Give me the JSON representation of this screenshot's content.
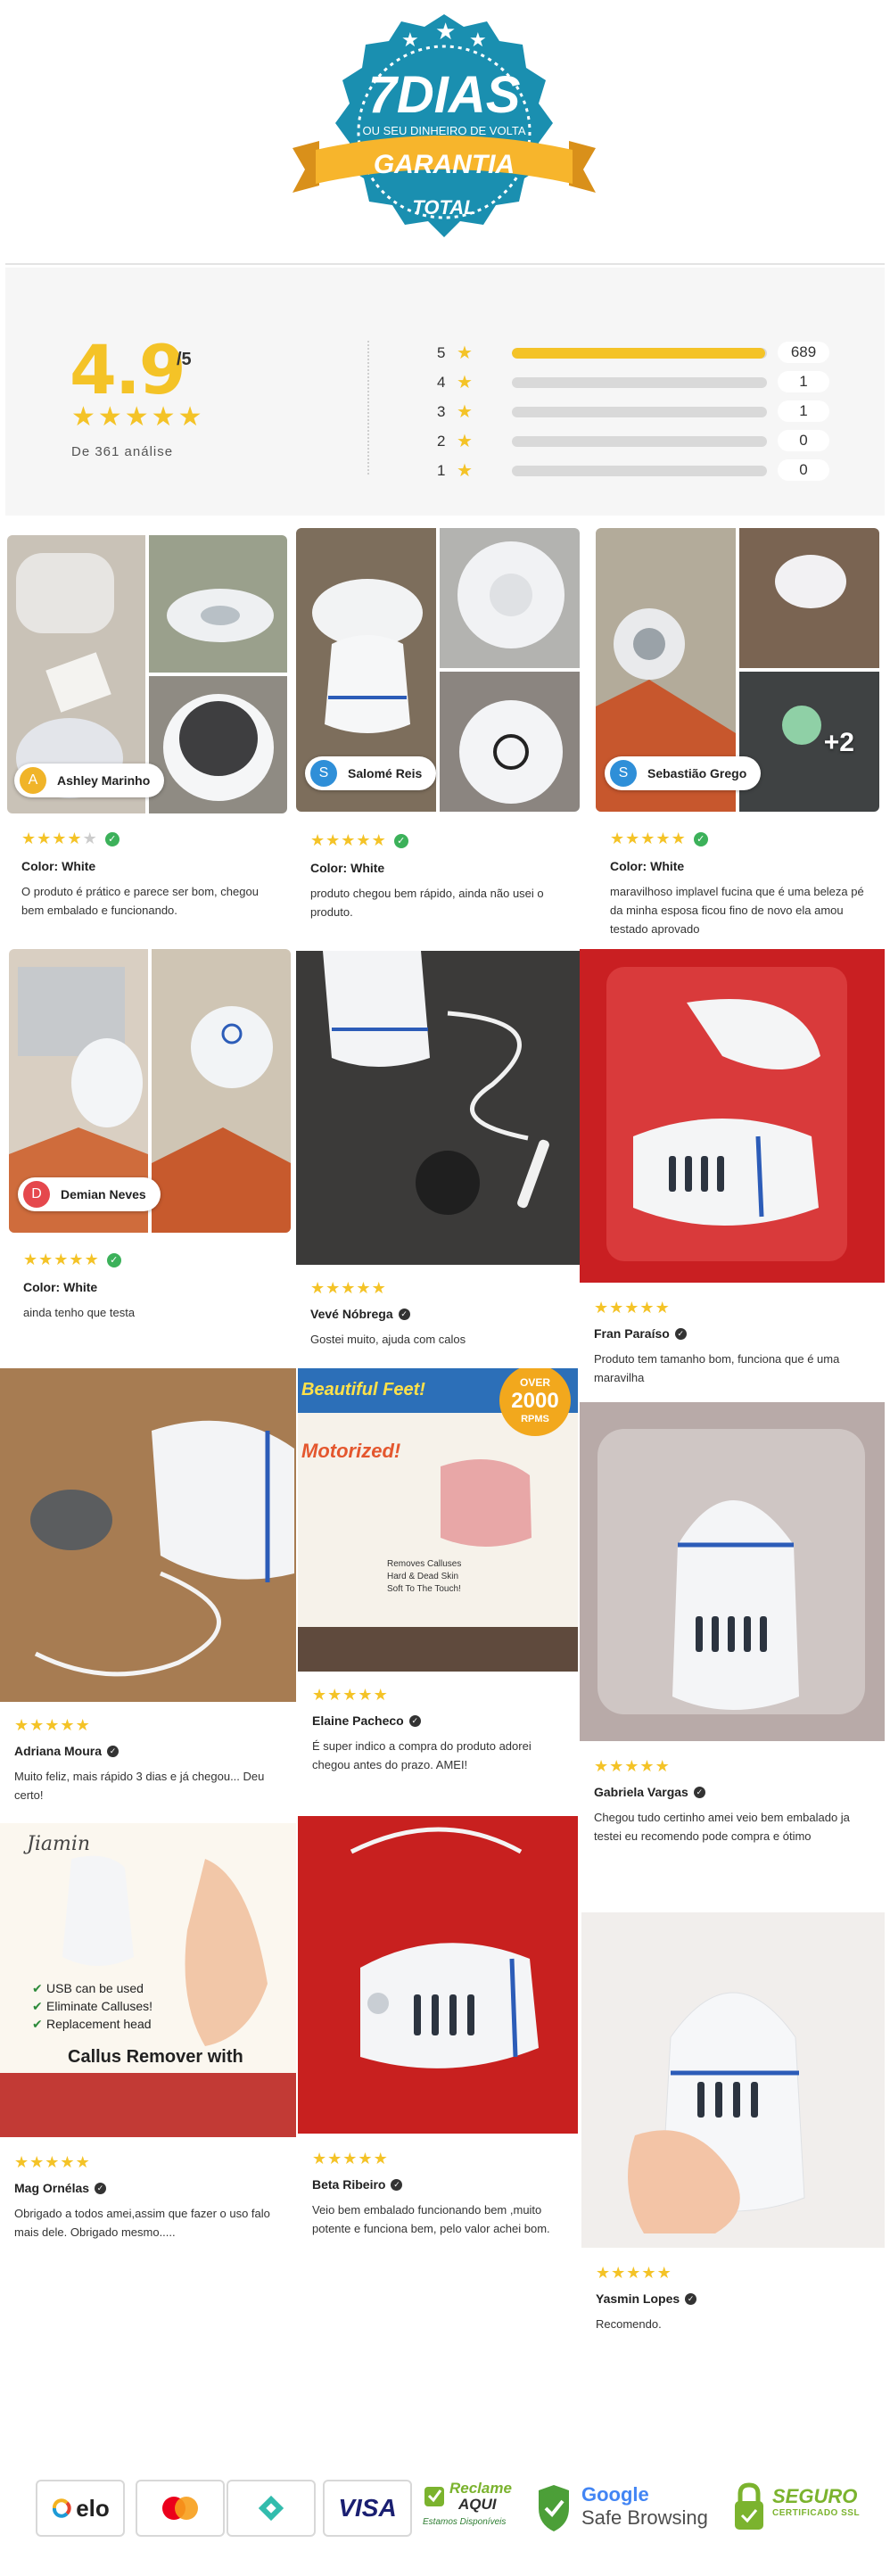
{
  "badge": {
    "big": "7DIAS",
    "sub": "OU SEU DINHEIRO DE VOLTA",
    "ribbon": "GARANTIA",
    "bottom": "TOTAL"
  },
  "summary": {
    "average": "4.9",
    "scale": "/5",
    "stars": "★★★★★",
    "count_text": "De 361 análise",
    "distribution": [
      {
        "stars": "5",
        "count": "689",
        "fraction": 0.994
      },
      {
        "stars": "4",
        "count": "1",
        "fraction": 0.0
      },
      {
        "stars": "3",
        "count": "1",
        "fraction": 0.0
      },
      {
        "stars": "2",
        "count": "0",
        "fraction": 0.0
      },
      {
        "stars": "1",
        "count": "0",
        "fraction": 0.0
      }
    ]
  },
  "reviews": [
    {
      "author": "Ashley Marinho",
      "initial": "A",
      "avatar_color": "#f0b429",
      "rating": 4,
      "color_label": "Color: White",
      "text": "O produto é prático e parece ser bom, chegou bem embalado e funcionando."
    },
    {
      "author": "Salomé Reis",
      "initial": "S",
      "avatar_color": "#2f8fd8",
      "rating": 5,
      "color_label": "Color: White",
      "text": "produto chegou bem rápido, ainda não usei o produto."
    },
    {
      "author": "Sebastião Grego",
      "initial": "S",
      "avatar_color": "#2f8fd8",
      "rating": 5,
      "color_label": "Color: White",
      "text": "maravilhoso implavel fucina que é uma beleza pé da minha esposa ficou fino de novo ela amou testado aprovado",
      "more_photos": "+2"
    },
    {
      "author": "Demian Neves",
      "initial": "D",
      "avatar_color": "#e5484d",
      "rating": 5,
      "color_label": "Color: White",
      "text": "ainda tenho que testa"
    },
    {
      "author": "Vevé Nóbrega",
      "rating": 5,
      "text": "Gostei muito, ajuda com calos"
    },
    {
      "author": "Fran Paraíso",
      "rating": 5,
      "text": "Produto tem tamanho bom, funciona que é uma maravilha"
    },
    {
      "author": "Adriana Moura",
      "rating": 5,
      "text": "Muito feliz, mais rápido 3 dias e já chegou... Deu certo!"
    },
    {
      "author": "Elaine Pacheco",
      "rating": 5,
      "text": "É super indico a compra do produto adorei chegou antes do prazo. AMEI!",
      "photo_text": {
        "top": "Beautiful Feet!",
        "badge_top": "OVER",
        "badge_mid": "2000",
        "badge_bot": "RPMS",
        "motor": "Motorized!",
        "box_line1": "Removes Calluses",
        "box_line2": "Hard & Dead Skin",
        "box_line3": "Soft To The Touch!"
      }
    },
    {
      "author": "Gabriela Vargas",
      "rating": 5,
      "text": "Chegou tudo certinho amei veio bem embalado ja testei eu recomendo pode compra e ótimo"
    },
    {
      "author": "Mag Ornélas",
      "rating": 5,
      "text": "Obrigado a todos amei,assim que fazer o uso falo mais dele. Obrigado mesmo.....",
      "photo_text": {
        "brand": "Jiamin",
        "bullets": [
          "USB can be used",
          "Eliminate Calluses!",
          "Replacement head"
        ],
        "title": "Callus Remover with"
      }
    },
    {
      "author": "Beta Ribeiro",
      "rating": 5,
      "text": "Veio bem embalado funcionando bem ,muito potente e funciona bem, pelo valor achei bom."
    },
    {
      "author": "Yasmin Lopes",
      "rating": 5,
      "text": "Recomendo."
    }
  ],
  "footer": {
    "elo": "elo",
    "visa": "VISA",
    "reclame_top": "Reclame",
    "reclame_mid": "AQUI",
    "reclame_bot": "Estamos Disponíveis",
    "google_top": "Google",
    "google_bot": "Safe Browsing",
    "seguro_top": "SEGURO",
    "seguro_bot": "CERTIFICADO SSL"
  },
  "colors": {
    "accent": "#f4c327",
    "badge_blue": "#1a8fb0",
    "ribbon": "#f7b52c",
    "verified": "#3cb15a"
  }
}
